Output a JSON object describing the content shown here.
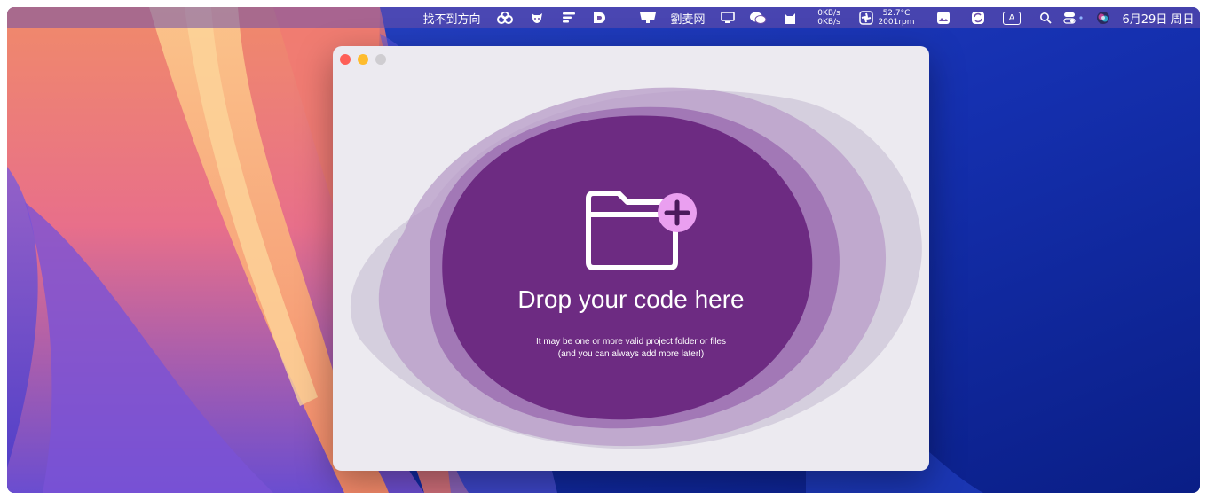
{
  "menubar": {
    "app_label": "找不到方向",
    "network_label": "劉麦网",
    "net_up": "0KB/s",
    "net_down": "0KB/s",
    "temperature": "52.7°C",
    "fan_speed": "2001rpm",
    "input_source": "A",
    "datetime": "6月29日 周日"
  },
  "window": {
    "drop_title": "Drop your code here",
    "drop_subtitle_line1": "It may be one or more valid project folder or files",
    "drop_subtitle_line2": "(and you can always add more later!)"
  },
  "colors": {
    "accent_purple": "#6d2b82",
    "plus_badge": "#ea9ff0",
    "window_bg": "#eceaf0",
    "close": "#fe5f57",
    "minimize": "#febc2e",
    "zoom": "#cfcdd1"
  }
}
